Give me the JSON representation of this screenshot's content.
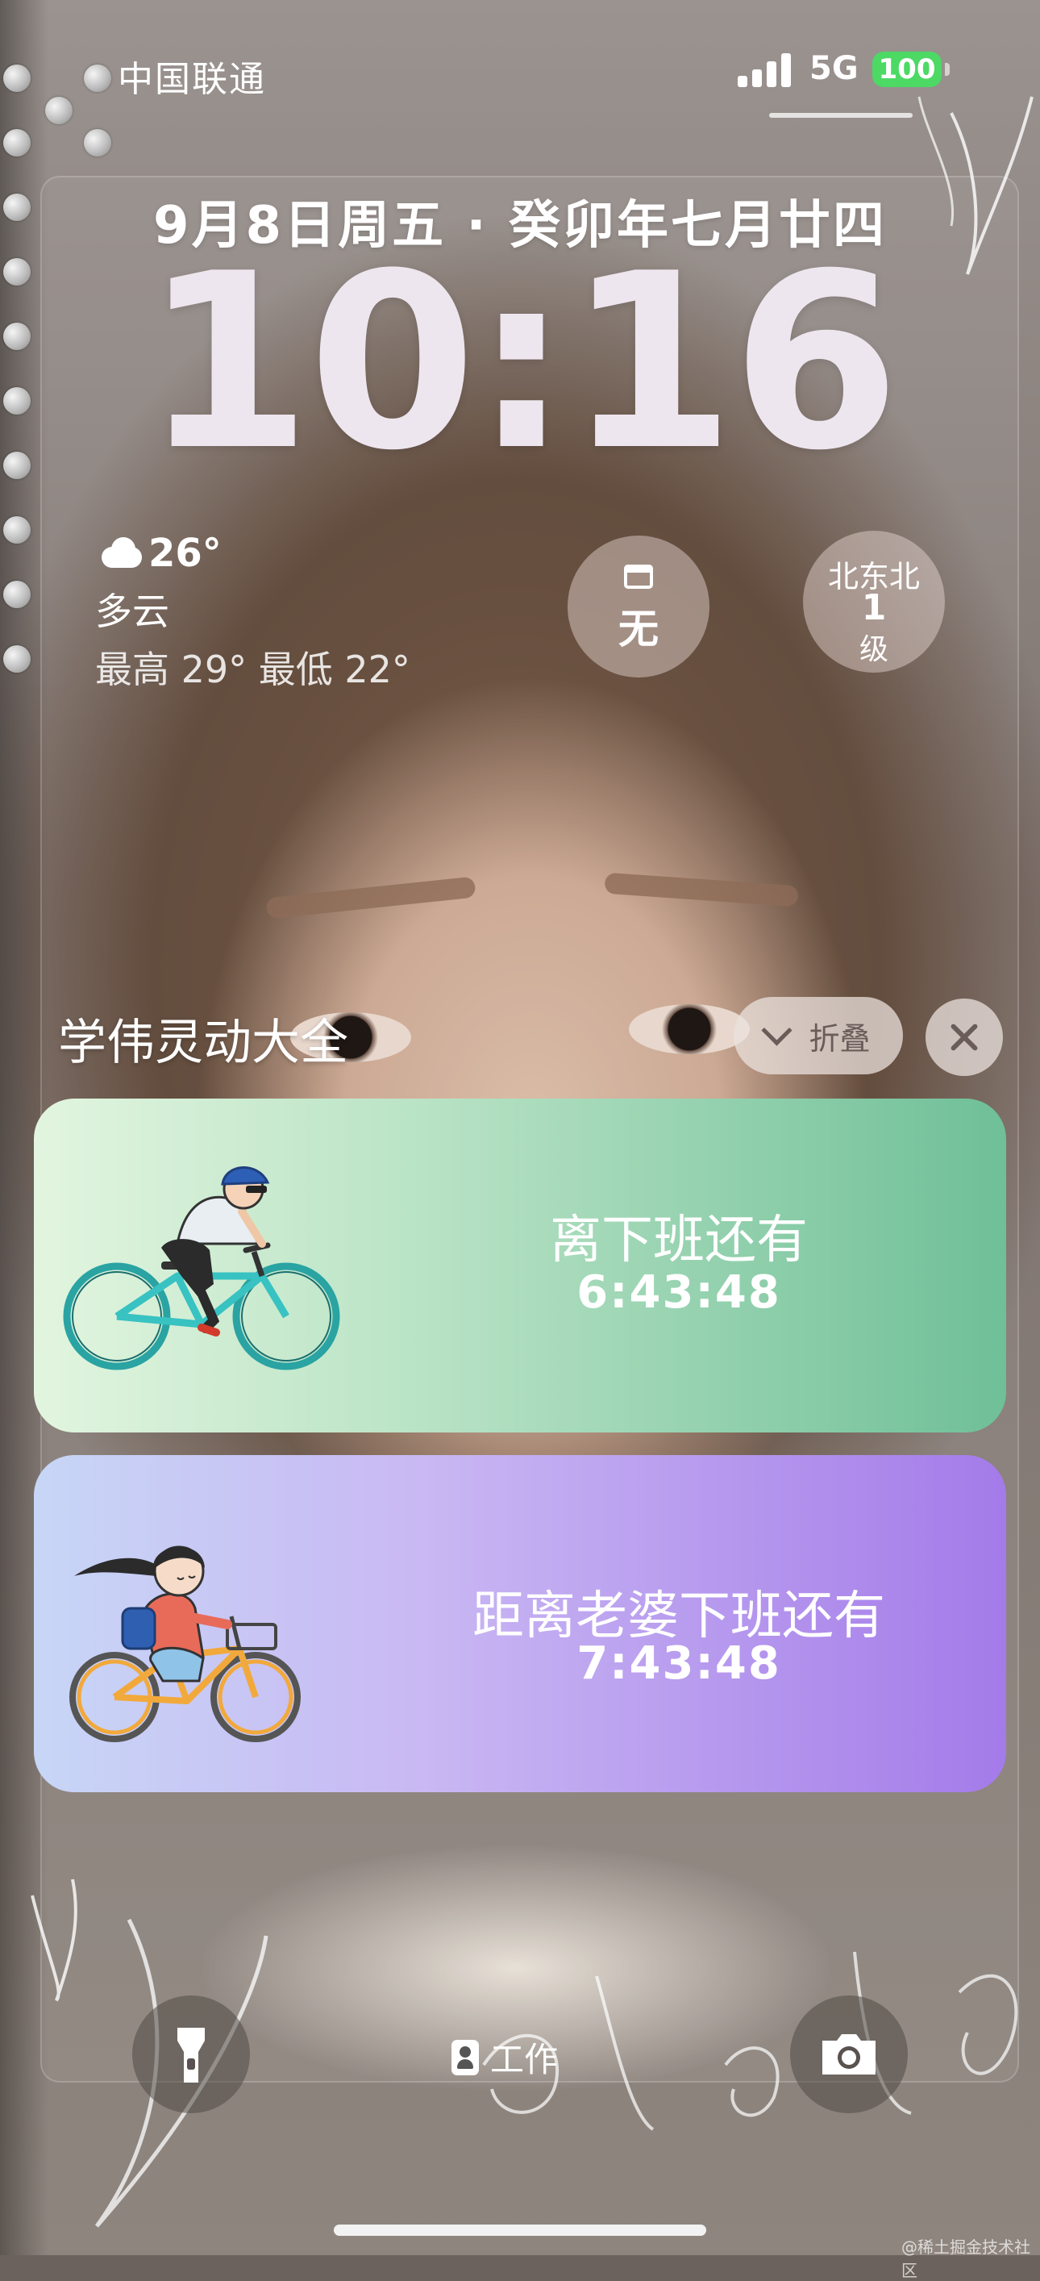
{
  "status_bar": {
    "carrier": "中国联通",
    "network": "5G",
    "battery": "100"
  },
  "lock_screen": {
    "date": "9月8日周五 · 癸卯年七月廿四",
    "time": "10:16"
  },
  "weather": {
    "temperature": "26°",
    "condition": "多云",
    "range": "最高 29° 最低 22°"
  },
  "widgets": {
    "traffic_limit": {
      "value": "无",
      "icon": "calendar-icon"
    },
    "wind": {
      "direction": "北东北",
      "level": "1",
      "unit": "级"
    }
  },
  "live_activities": {
    "group_title": "学伟灵动大全",
    "collapse_label": "折叠",
    "cards": [
      {
        "label": "离下班还有",
        "countdown": "6:43:48",
        "illustration": "cyclist-man"
      },
      {
        "label": "距离老婆下班还有",
        "countdown": "7:43:48",
        "illustration": "cyclist-woman"
      }
    ]
  },
  "bottom": {
    "focus_label": "工作",
    "flashlight_icon": "flashlight-icon",
    "camera_icon": "camera-icon"
  },
  "watermark": "@稀土掘金技术社区",
  "colors": {
    "battery": "#4cd964",
    "card1_accent": "#6fbf98",
    "card2_accent": "#a47be9"
  }
}
